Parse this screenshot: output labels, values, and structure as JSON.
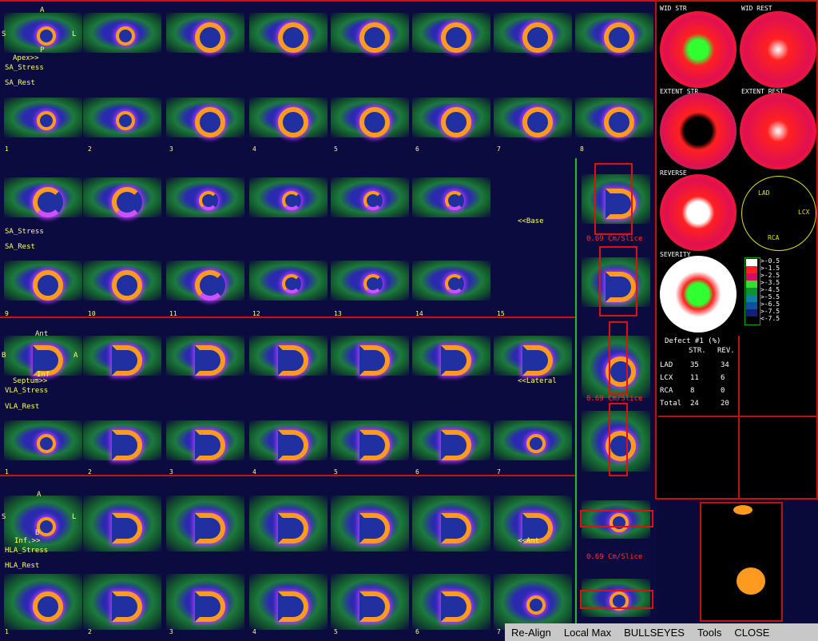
{
  "orientation": {
    "a": "A",
    "s": "S",
    "l": "L",
    "p": "P",
    "apex": "Apex>>",
    "base": "<<Base",
    "ant": "Ant",
    "inf": "Inf",
    "septum": "Septum>>",
    "lateral": "<<Lateral",
    "ant2": "<<Ant",
    "inf2": "Inf.>>",
    "b": "B"
  },
  "rows": {
    "sa_stress": "SA_Stress",
    "sa_rest": "SA_Rest",
    "vla_stress": "VLA_Stress",
    "vla_rest": "VLA_Rest",
    "hla_stress": "HLA_Stress",
    "hla_rest": "HLA_Rest"
  },
  "slice_numbers_1": [
    "1",
    "2",
    "3",
    "4",
    "5",
    "6",
    "7",
    "8"
  ],
  "slice_numbers_2": [
    "9",
    "10",
    "11",
    "12",
    "13",
    "14",
    "15"
  ],
  "slice_numbers_3": [
    "1",
    "2",
    "3",
    "4",
    "5",
    "6",
    "7"
  ],
  "slice_numbers_4": [
    "1",
    "2",
    "3",
    "4",
    "5",
    "6",
    "7"
  ],
  "slice_thickness": "0.69 Cm/Slice",
  "bullseyes": {
    "wid_str": "WID STR",
    "wid_rest": "WID REST",
    "extent_str": "EXTENT STR",
    "extent_rest": "EXTENT REST",
    "reverse": "REVERSE",
    "severity": "SEVERITY",
    "lad": "LAD",
    "lcx": "LCX",
    "rca": "RCA"
  },
  "legend": [
    {
      "label": ">-0.5",
      "color": "#ffffff"
    },
    {
      "label": ">-1.5",
      "color": "#ff2020"
    },
    {
      "label": ">-2.5",
      "color": "#d01060"
    },
    {
      "label": ">-3.5",
      "color": "#30e030"
    },
    {
      "label": ">-4.5",
      "color": "#109030"
    },
    {
      "label": ">-5.5",
      "color": "#1080a0"
    },
    {
      "label": ">-6.5",
      "color": "#1050a0"
    },
    {
      "label": ">-7.5",
      "color": "#102080"
    },
    {
      "label": "<-7.5",
      "color": "#000000"
    }
  ],
  "defect_table": {
    "title": "Defect #1 (%)",
    "headers": [
      "STR.",
      "REV."
    ],
    "rows": [
      {
        "name": "LAD",
        "str": "35",
        "rev": "34"
      },
      {
        "name": "LCX",
        "str": "11",
        "rev": "6"
      },
      {
        "name": "RCA",
        "str": "8",
        "rev": "0"
      },
      {
        "name": "Total",
        "str": "24",
        "rev": "20"
      }
    ]
  },
  "toolbar": {
    "realign": "Re-Align",
    "localmax": "Local Max",
    "bullseyes": "BULLSEYES",
    "tools": "Tools",
    "close": "CLOSE"
  }
}
